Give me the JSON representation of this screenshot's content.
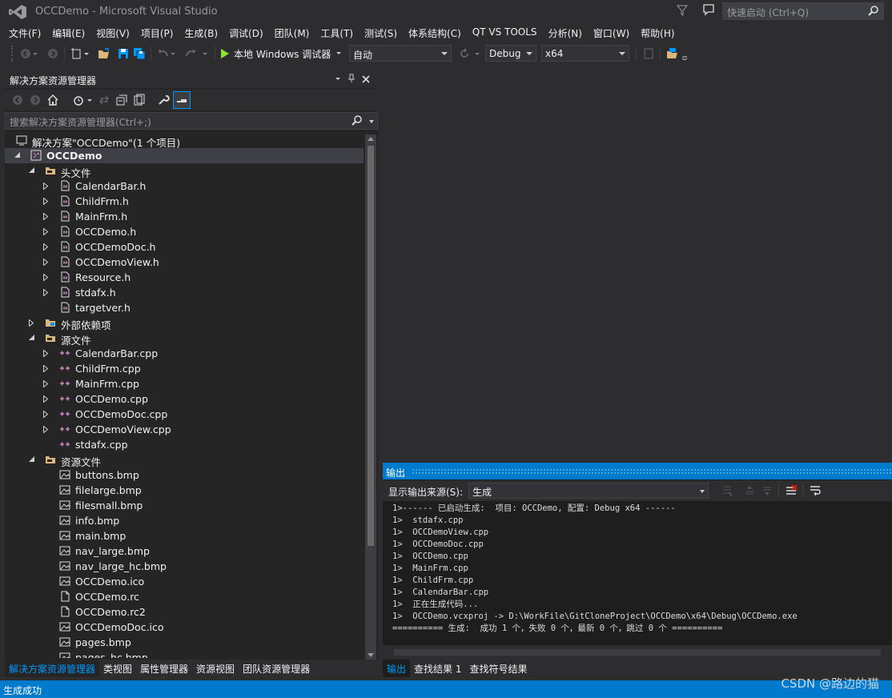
{
  "window": {
    "title": "OCCDemo - Microsoft Visual Studio",
    "quick_launch_placeholder": "快速启动 (Ctrl+Q)"
  },
  "menu": [
    "文件(F)",
    "编辑(E)",
    "视图(V)",
    "项目(P)",
    "生成(B)",
    "调试(D)",
    "团队(M)",
    "工具(T)",
    "测试(S)",
    "体系结构(C)",
    "QT VS TOOLS",
    "分析(N)",
    "窗口(W)",
    "帮助(H)"
  ],
  "toolbar": {
    "run_label": "本地 Windows 调试器",
    "run_mode": "自动",
    "configuration": "Debug",
    "platform": "x64"
  },
  "solution_explorer": {
    "title": "解决方案资源管理器",
    "search_placeholder": "搜索解决方案资源管理器(Ctrl+;)",
    "solution_label": "解决方案\"OCCDemo\"(1 个项目)",
    "project_label": "OCCDemo",
    "folders": {
      "headers": "头文件",
      "external": "外部依赖项",
      "sources": "源文件",
      "resources": "资源文件"
    },
    "header_files": [
      "CalendarBar.h",
      "ChildFrm.h",
      "MainFrm.h",
      "OCCDemo.h",
      "OCCDemoDoc.h",
      "OCCDemoView.h",
      "Resource.h",
      "stdafx.h",
      "targetver.h"
    ],
    "source_files": [
      "CalendarBar.cpp",
      "ChildFrm.cpp",
      "MainFrm.cpp",
      "OCCDemo.cpp",
      "OCCDemoDoc.cpp",
      "OCCDemoView.cpp",
      "stdafx.cpp"
    ],
    "resource_files": [
      "buttons.bmp",
      "filelarge.bmp",
      "filesmall.bmp",
      "info.bmp",
      "main.bmp",
      "nav_large.bmp",
      "nav_large_hc.bmp",
      "OCCDemo.ico",
      "OCCDemo.rc",
      "OCCDemo.rc2",
      "OCCDemoDoc.ico",
      "pages.bmp",
      "pages_hc.bmp"
    ],
    "bottom_tabs": [
      "解决方案资源管理器",
      "类视图",
      "属性管理器",
      "资源视图",
      "团队资源管理器"
    ]
  },
  "output": {
    "title": "输出",
    "source_label": "显示输出来源(S):",
    "source_value": "生成",
    "lines": [
      "1>------ 已启动生成:  项目: OCCDemo, 配置: Debug x64 ------",
      "1>  stdafx.cpp",
      "1>  OCCDemoView.cpp",
      "1>  OCCDemoDoc.cpp",
      "1>  OCCDemo.cpp",
      "1>  MainFrm.cpp",
      "1>  ChildFrm.cpp",
      "1>  CalendarBar.cpp",
      "1>  正在生成代码...",
      "1>  OCCDemo.vcxproj -> D:\\WorkFile\\GitCloneProject\\OCCDemo\\x64\\Debug\\OCCDemo.exe",
      "========== 生成:  成功 1 个，失败 0 个，最新 0 个，跳过 0 个 =========="
    ],
    "bottom_tabs": [
      "输出",
      "查找结果 1",
      "查找符号结果"
    ]
  },
  "status": {
    "text": "生成成功"
  },
  "watermark": "CSDN @路边的猫",
  "colors": {
    "accent": "#007acc",
    "background": "#2d2d30",
    "panel": "#252526",
    "tab_active": "#0097fb"
  }
}
